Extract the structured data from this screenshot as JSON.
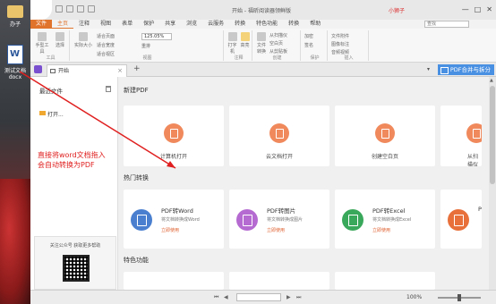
{
  "desktop": {
    "folder_label": "办子",
    "doc_label": "测试文档\ndocx"
  },
  "window": {
    "title": "开始 - 福昕阅读器领鲜版",
    "user": "小狮子",
    "min": "—",
    "max": "□",
    "close": "✕"
  },
  "menu": {
    "file": "文件",
    "items": [
      "主页",
      "注释",
      "视图",
      "表单",
      "保护",
      "共享",
      "浏览",
      "云服务",
      "转换",
      "特色功能",
      "转换",
      "帮助"
    ],
    "active_index": 0,
    "search_placeholder": "查找"
  },
  "ribbon": {
    "groups": [
      {
        "label": "工具",
        "buttons": [
          "手型工具",
          "选择"
        ]
      },
      {
        "label": "视图",
        "buttons": [
          "实际大小",
          "适合页面",
          "适合宽度",
          "适合视区",
          "重排"
        ]
      },
      {
        "label": "注释",
        "buttons": [
          "打字机",
          "高亮"
        ]
      },
      {
        "label": "创建",
        "buttons": [
          "文件转换",
          "从扫描仪",
          "空白页",
          "从剪贴板"
        ]
      },
      {
        "label": "保护",
        "buttons": [
          "加密",
          "签名"
        ]
      },
      {
        "label": "插入",
        "buttons": [
          "文件附件",
          "图像标注",
          "音频视频"
        ]
      }
    ],
    "zoom": "125.05%"
  },
  "tabs": {
    "doc_tab": "开始",
    "close": "×",
    "add": "+",
    "dropdown": "▾",
    "pdf_merge": "PDF合并与拆分"
  },
  "left_panel": {
    "recent_title": "最近文件",
    "open_label": "打开...",
    "qr_text": "关注公众号 获取更多帮助"
  },
  "sections": {
    "new_pdf": "新建PDF",
    "hot_convert": "热门转换",
    "featured": "特色功能"
  },
  "new_pdf_cards": [
    "计算机打开",
    "云文档打开",
    "创建空白页",
    "从扫描仪"
  ],
  "convert_cards": [
    {
      "title": "PDF转Word",
      "desc": "将文档转换成Word",
      "link": "立即使用",
      "color": "#4a7fd0"
    },
    {
      "title": "PDF转图片",
      "desc": "将文档转换成图片",
      "link": "立即使用",
      "color": "#b56ad1"
    },
    {
      "title": "PDF转Excel",
      "desc": "将文档转换成Excel",
      "link": "立即使用",
      "color": "#3aa85a"
    },
    {
      "title": "PI",
      "desc": "",
      "link": "",
      "color": "#e8703a"
    }
  ],
  "statusbar": {
    "first": "⏮",
    "prev": "◀",
    "next": "▶",
    "last": "⏭",
    "zoom": "100%"
  },
  "annotation": {
    "text": "直接将word文档拖入\n会自动转换为PDF",
    "color": "#e02020"
  }
}
